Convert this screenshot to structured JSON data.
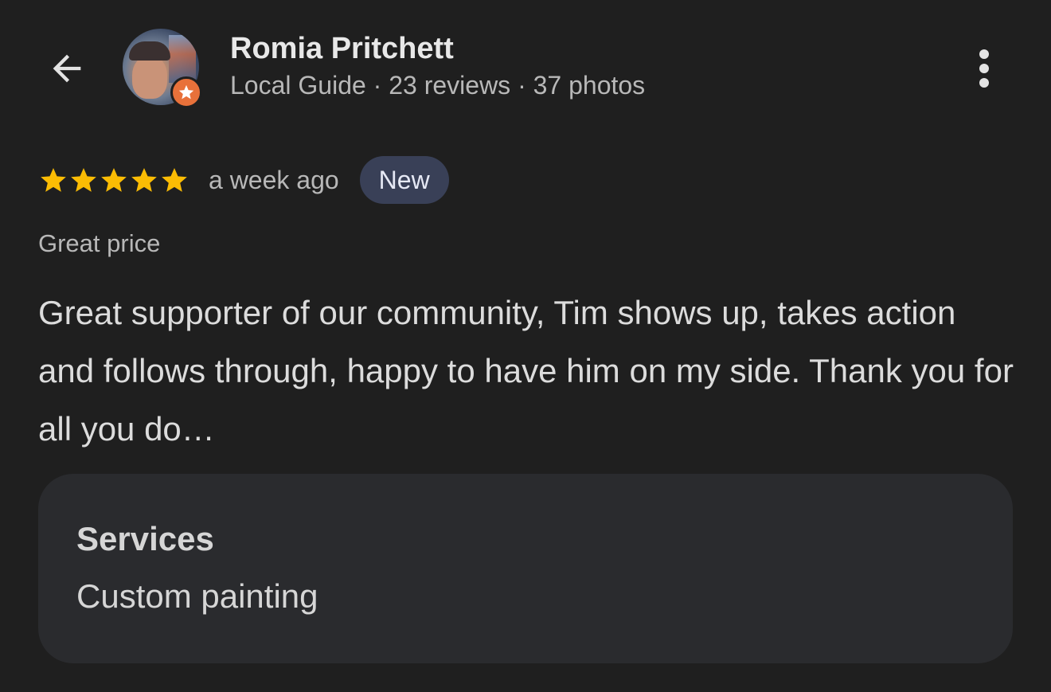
{
  "header": {
    "back_icon": "arrow-back-icon",
    "more_icon": "more-vertical-icon"
  },
  "reviewer": {
    "name": "Romia Pritchett",
    "meta": "Local Guide · 23 reviews · 37 photos",
    "badge_icon": "local-guide-star-icon",
    "badge_color": "#e8713a"
  },
  "review": {
    "rating": 5,
    "rating_max": 5,
    "star_color": "#fbbc04",
    "date": "a week ago",
    "badge": "New",
    "tag": "Great price",
    "text": "Great supporter of our community, Tim shows up, takes action and follows through, happy to have him on my side. Thank you for all you do…"
  },
  "services": {
    "title": "Services",
    "value": "Custom painting"
  }
}
